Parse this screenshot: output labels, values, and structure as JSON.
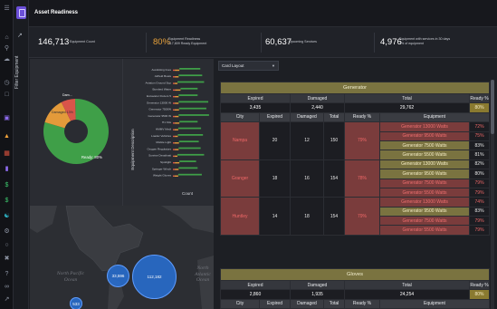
{
  "header": {
    "title": "Asset Readiness"
  },
  "filter": {
    "label": "Filter Equipment"
  },
  "kpis": [
    {
      "value": "146,713",
      "label": "Equipment Count"
    },
    {
      "value": "80%",
      "label_line1": "Equipment Readiness",
      "label_line2": "117,809 Ready Equipment"
    },
    {
      "value": "60,637",
      "label": "Upcoming Services"
    },
    {
      "value": "4,976",
      "label_line1": "Equipment with services in 30 days",
      "label_line2": "3% of equipment"
    }
  ],
  "pie": {
    "labels": {
      "ready": "Ready: 80%",
      "damaged": "Damaged 13%",
      "other": "Dam..."
    },
    "slices": [
      {
        "name": "Ready",
        "value": 80,
        "color": "#3f9f48"
      },
      {
        "name": "Damaged",
        "value": 13,
        "color": "#e39a3a"
      },
      {
        "name": "Other",
        "value": 7,
        "color": "#d8544a"
      }
    ]
  },
  "bar_chart": {
    "ylabel": "Equipment Description",
    "xlabel": "Count",
    "categories": [
      "Austinking lines",
      "Airfield Boats",
      "Aviation Ground Sup",
      "Bombed Water",
      "Excavator Dozers 5",
      "Generator 13000 W",
      "Generator 7500W",
      "Generator 9500 W",
      "H1 Kits",
      "HMMV Medi",
      "Loader Vehicles",
      "Mobile Light",
      "Oxygen Regulators",
      "Sunrise Desalinati",
      "Spotlight",
      "Springer Winch",
      "Weight Gloves"
    ],
    "green_fraction": [
      0.55,
      0.62,
      0.7,
      0.45,
      0.5,
      0.78,
      0.72,
      0.8,
      0.48,
      0.6,
      0.66,
      0.52,
      0.58,
      0.7,
      0.44,
      0.5,
      0.62
    ],
    "orange_fraction": [
      0.12,
      0.1,
      0.08,
      0.14,
      0.1,
      0.1,
      0.12,
      0.1,
      0.12,
      0.1,
      0.08,
      0.12,
      0.1,
      0.08,
      0.12,
      0.1,
      0.1
    ],
    "red_fraction": [
      0.05,
      0.05,
      0.04,
      0.06,
      0.05,
      0.05,
      0.04,
      0.05,
      0.05,
      0.04,
      0.05,
      0.04,
      0.05,
      0.04,
      0.05,
      0.05,
      0.04
    ]
  },
  "map": {
    "labels": {
      "pacific": "North Pacific\nOcean",
      "atlantic": "North\nAtlantic\nOcean"
    },
    "bubbles": [
      {
        "label": "33,596"
      },
      {
        "label": "112,182"
      },
      {
        "label": "533"
      }
    ]
  },
  "card_layout": {
    "selected": "Card Layout"
  },
  "groups": [
    {
      "title": "Generator",
      "summary_headers": [
        "Expired",
        "Damaged",
        "Total",
        "Ready %"
      ],
      "summary_values": [
        "3,435",
        "2,440",
        "29,762",
        "80%"
      ],
      "col_headers": [
        "City",
        "Expired",
        "Damaged",
        "Total",
        "Ready %",
        "Equipment"
      ],
      "cities": [
        {
          "city": "Nampa",
          "expired": "20",
          "damaged": "12",
          "total": "150",
          "ready": "79%",
          "equipment": [
            {
              "name": "Generator 13000 Watts",
              "pct": "72%",
              "tone": "red"
            },
            {
              "name": "Generator 9500 Watts",
              "pct": "75%",
              "tone": "red"
            },
            {
              "name": "Generator 7500 Watts",
              "pct": "83%",
              "tone": "gold"
            },
            {
              "name": "Generator 5500 Watts",
              "pct": "81%",
              "tone": "gold"
            }
          ]
        },
        {
          "city": "Granger",
          "expired": "18",
          "damaged": "16",
          "total": "154",
          "ready": "78%",
          "equipment": [
            {
              "name": "Generator 13000 Watts",
              "pct": "82%",
              "tone": "gold"
            },
            {
              "name": "Generator 9500 Watts",
              "pct": "80%",
              "tone": "gold"
            },
            {
              "name": "Generator 7500 Watts",
              "pct": "79%",
              "tone": "red"
            },
            {
              "name": "Generator 5500 Watts",
              "pct": "79%",
              "tone": "red"
            }
          ]
        },
        {
          "city": "Huntley",
          "expired": "14",
          "damaged": "18",
          "total": "154",
          "ready": "79%",
          "equipment": [
            {
              "name": "Generator 13000 Watts",
              "pct": "74%",
              "tone": "red"
            },
            {
              "name": "Generator 9500 Watts",
              "pct": "83%",
              "tone": "gold"
            },
            {
              "name": "Generator 7500 Watts",
              "pct": "79%",
              "tone": "red"
            },
            {
              "name": "Generator 5500 Watts",
              "pct": "79%",
              "tone": "red"
            }
          ]
        }
      ]
    },
    {
      "title": "Gloves",
      "summary_headers": [
        "Expired",
        "Damaged",
        "Total",
        "Ready %"
      ],
      "summary_values": [
        "2,860",
        "1,935",
        "24,254",
        "80%"
      ],
      "col_headers": [
        "City",
        "Expired",
        "Damaged",
        "Total",
        "Ready %",
        "Equipment"
      ]
    }
  ],
  "colors": {
    "accent_purple": "#6b4fd8",
    "ready_green": "#3f9f48",
    "damaged_orange": "#e39a3a",
    "expired_red": "#d8544a",
    "gold_header": "#7a7340",
    "map_bubble": "#2870d6"
  },
  "rail_icons": [
    "menu-icon",
    "home-icon",
    "search-icon",
    "cloud-icon",
    "clock-icon",
    "folder-icon",
    "layers-icon",
    "chart-icon",
    "grid-icon",
    "bar-chart-icon",
    "dollar-icon",
    "people-icon",
    "gear-icon",
    "plug-icon",
    "help-icon",
    "link-icon",
    "expand-icon"
  ]
}
